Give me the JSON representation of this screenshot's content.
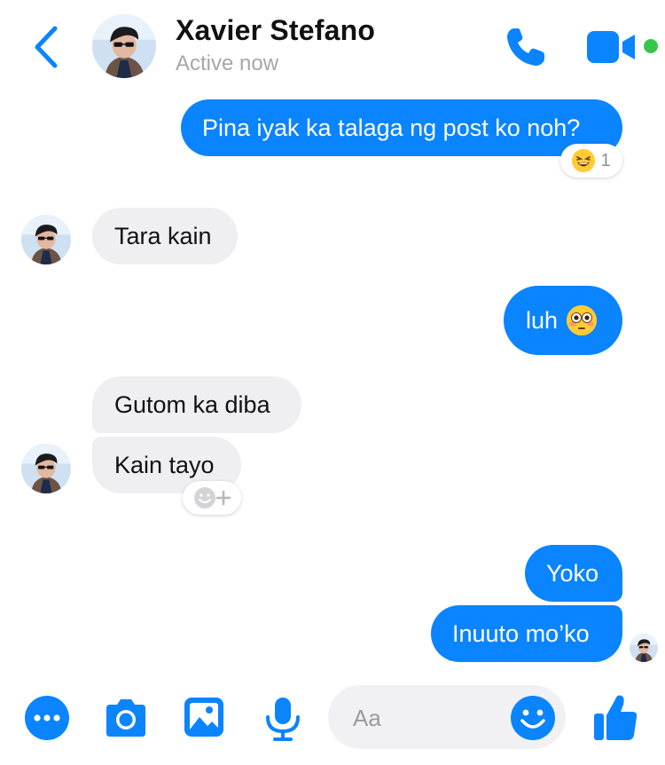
{
  "header": {
    "contact_name": "Xavier Stefano",
    "status": "Active now"
  },
  "messages": [
    {
      "text": "Pina iyak ka talaga ng post ko noh?",
      "reaction_count": "1"
    },
    {
      "text": "Tara kain"
    },
    {
      "text": "luh"
    },
    {
      "text": "Gutom ka diba"
    },
    {
      "text": "Kain tayo"
    },
    {
      "text": "Yoko"
    },
    {
      "text": "Inuuto mo’ko"
    }
  ],
  "composer": {
    "placeholder": "Aa"
  },
  "colors": {
    "accent": "#0a84ff",
    "incoming_bubble": "#efeff2",
    "online": "#35c74a"
  },
  "icons": [
    "chevron-left-icon",
    "phone-icon",
    "video-camera-icon",
    "more-icon",
    "camera-icon",
    "image-icon",
    "microphone-icon",
    "smiley-icon",
    "thumbs-up-icon"
  ]
}
